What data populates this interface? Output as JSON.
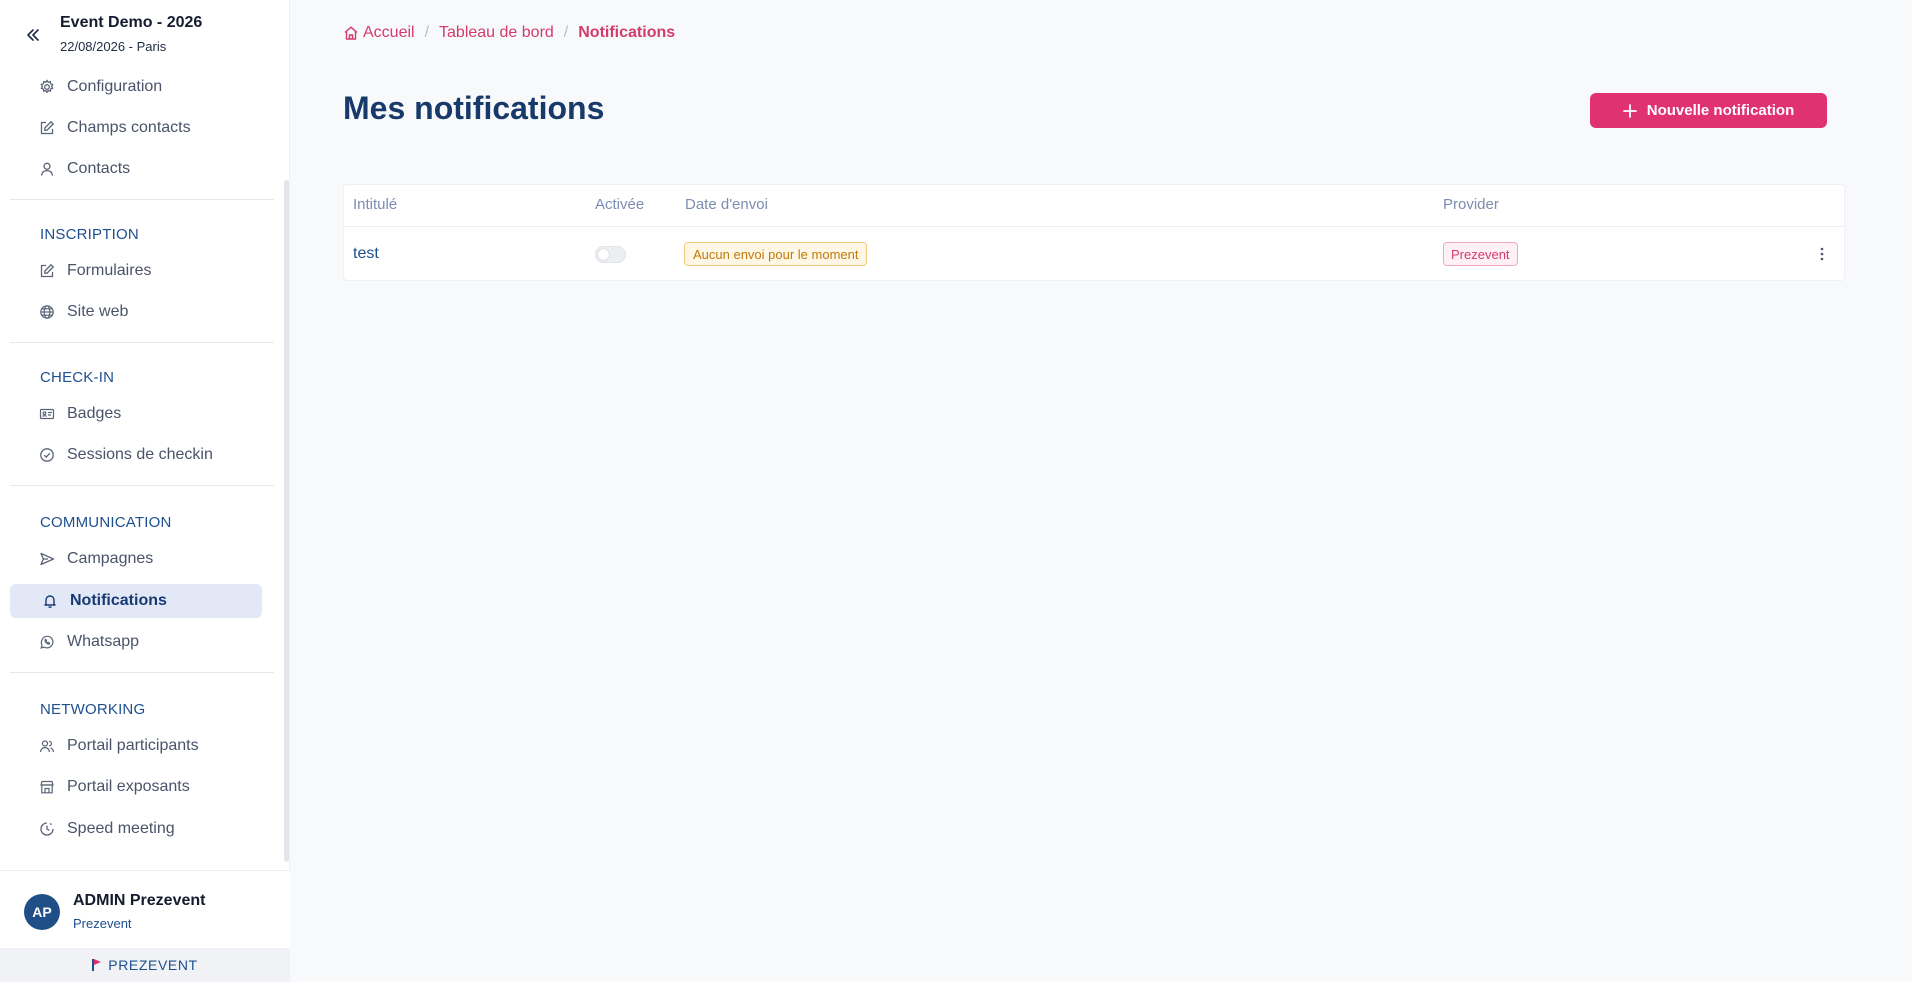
{
  "sidebar": {
    "event": {
      "title": "Event Demo - 2026",
      "subtitle": "22/08/2026 - Paris"
    },
    "top_items": [
      {
        "label": "Configuration",
        "icon": "gear-icon"
      },
      {
        "label": "Champs contacts",
        "icon": "edit-icon"
      },
      {
        "label": "Contacts",
        "icon": "user-icon"
      }
    ],
    "sections": [
      {
        "title": "INSCRIPTION",
        "items": [
          {
            "label": "Formulaires",
            "icon": "edit-icon"
          },
          {
            "label": "Site web",
            "icon": "globe-icon"
          }
        ]
      },
      {
        "title": "CHECK-IN",
        "items": [
          {
            "label": "Badges",
            "icon": "id-card-icon"
          },
          {
            "label": "Sessions de checkin",
            "icon": "check-circle-icon"
          }
        ]
      },
      {
        "title": "COMMUNICATION",
        "items": [
          {
            "label": "Campagnes",
            "icon": "send-icon"
          },
          {
            "label": "Notifications",
            "icon": "bell-icon",
            "active": true
          },
          {
            "label": "Whatsapp",
            "icon": "whatsapp-icon"
          }
        ]
      },
      {
        "title": "NETWORKING",
        "items": [
          {
            "label": "Portail participants",
            "icon": "users-icon"
          },
          {
            "label": "Portail exposants",
            "icon": "store-icon"
          },
          {
            "label": "Speed meeting",
            "icon": "clock-icon"
          }
        ]
      }
    ],
    "user": {
      "initials": "AP",
      "name": "ADMIN Prezevent",
      "org": "Prezevent"
    },
    "brand": "PREZEVENT"
  },
  "breadcrumb": {
    "items": [
      "Accueil",
      "Tableau de bord",
      "Notifications"
    ],
    "separator": "/"
  },
  "page": {
    "title": "Mes notifications",
    "new_button": "Nouvelle notification"
  },
  "table": {
    "columns": [
      "Intitulé",
      "Activée",
      "Date d'envoi",
      "Provider"
    ],
    "rows": [
      {
        "name": "test",
        "enabled": false,
        "send_date": "Aucun envoi pour le moment",
        "provider": "Prezevent"
      }
    ]
  },
  "colors": {
    "accent": "#e03170",
    "primary": "#173a6a",
    "section": "#1e4f8f",
    "active_bg": "#e2e8f6"
  }
}
